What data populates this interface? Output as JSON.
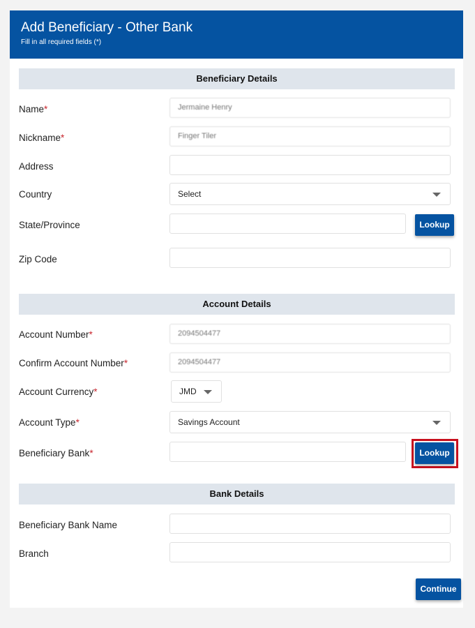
{
  "header": {
    "title": "Add Beneficiary - Other Bank",
    "subtitle": "Fill in all required fields (*)",
    "color": "#0553a1"
  },
  "sections": {
    "beneficiary": "Beneficiary Details",
    "account": "Account Details",
    "bank": "Bank Details"
  },
  "required_marker": "*",
  "beneficiary_details": {
    "name": {
      "label": "Name",
      "value": "Jermaine Henry"
    },
    "nickname": {
      "label": "Nickname",
      "value": "Finger Tiler"
    },
    "address": {
      "label": "Address",
      "value": ""
    },
    "country": {
      "label": "Country",
      "value": "Select"
    },
    "state": {
      "label": "State/Province",
      "value": "",
      "lookup_label": "Lookup"
    },
    "zip": {
      "label": "Zip Code",
      "value": ""
    }
  },
  "account_details": {
    "account_number": {
      "label": "Account Number",
      "value": "2094504477"
    },
    "confirm_account_number": {
      "label": "Confirm Account Number",
      "value": "2094504477"
    },
    "currency": {
      "label": "Account Currency",
      "value": "JMD"
    },
    "account_type": {
      "label": "Account Type",
      "value": "Savings Account"
    },
    "beneficiary_bank": {
      "label": "Beneficiary Bank",
      "value": "",
      "lookup_label": "Lookup"
    }
  },
  "bank_details": {
    "bank_name": {
      "label": "Beneficiary Bank Name",
      "value": ""
    },
    "branch": {
      "label": "Branch",
      "value": ""
    }
  },
  "actions": {
    "continue_label": "Continue"
  },
  "highlight_color": "#c8101e"
}
